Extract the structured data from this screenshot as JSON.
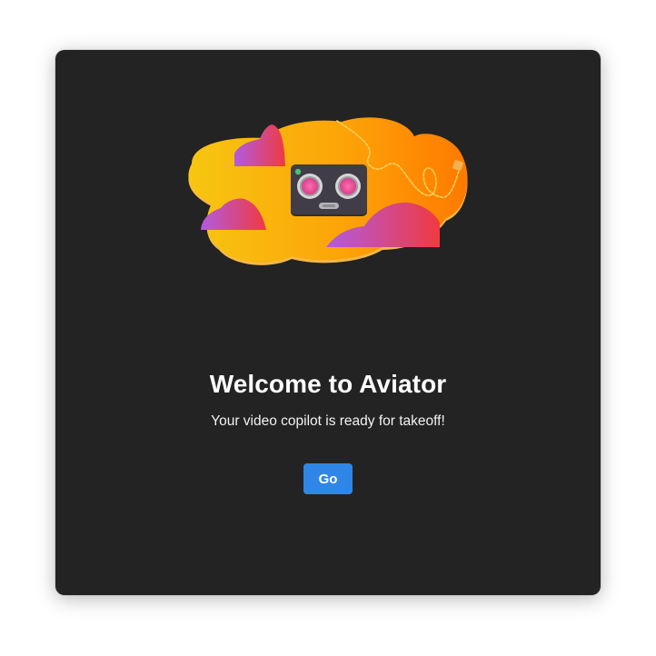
{
  "onboarding": {
    "title": "Welcome to Aviator",
    "subtitle": "Your video copilot is ready for takeoff!",
    "go_label": "Go"
  },
  "illustration": {
    "name": "robot-cloud-illustration",
    "colors": {
      "cloud_yellow": "#f7c411",
      "cloud_orange": "#ff7d00",
      "puff_purple": "#b45ad6",
      "puff_red": "#f03a45",
      "robot_body": "#3d3a44",
      "robot_eye": "#e94d8c",
      "cable": "#f9cf5a"
    }
  },
  "colors": {
    "window_background": "#232323",
    "button_accent": "#2f86e6",
    "text": "#ffffff"
  }
}
